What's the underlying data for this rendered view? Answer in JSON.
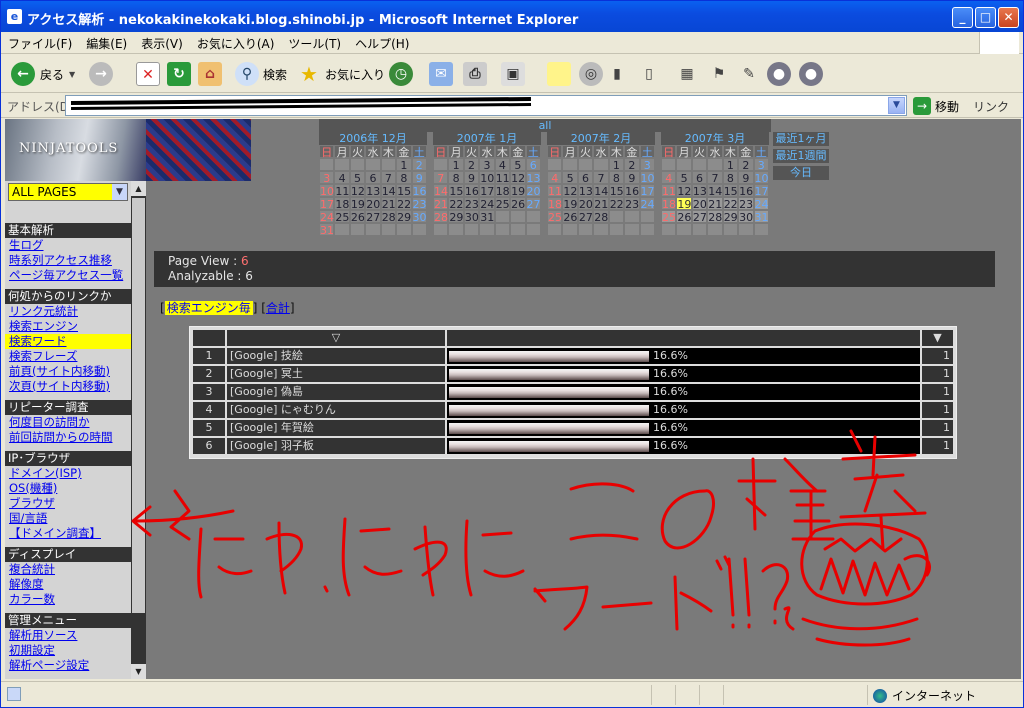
{
  "window": {
    "title": "アクセス解析 - nekokakinekokaki.blog.shinobi.jp - Microsoft Internet Explorer",
    "minimize": "_",
    "maximize": "□",
    "close": "✕"
  },
  "menu": [
    "ファイル(F)",
    "編集(E)",
    "表示(V)",
    "お気に入り(A)",
    "ツール(T)",
    "ヘルプ(H)"
  ],
  "toolbar": {
    "back": "戻る",
    "search": "検索",
    "favorites": "お気に入り"
  },
  "address": {
    "label": "アドレス(D)",
    "go": "移動",
    "links": "リンク"
  },
  "sidebar": {
    "logo": "NINJATOOLS",
    "select": "ALL PAGES",
    "sections": [
      {
        "title": "基本解析",
        "items": [
          "生ログ",
          "時系列アクセス推移",
          "ページ毎アクセス一覧"
        ]
      },
      {
        "title": "何処からのリンクか",
        "items": [
          "リンク元統計",
          "検索エンジン",
          "検索ワード",
          "検索フレーズ",
          "前頁(サイト内移動)",
          "次頁(サイト内移動)"
        ]
      },
      {
        "title": "リピーター調査",
        "items": [
          "何度目の訪問か",
          "前回訪問からの時間"
        ]
      },
      {
        "title": "IP･ブラウザ",
        "items": [
          "ドメイン(ISP)",
          "OS(機種)",
          "ブラウザ",
          "国/言語",
          "【ドメイン調査】"
        ]
      },
      {
        "title": "ディスプレイ",
        "items": [
          "複合統計",
          "解像度",
          "カラー数"
        ]
      },
      {
        "title": "管理メニュー",
        "items": [
          "解析用ソース",
          "初期設定",
          "解析ページ設定"
        ]
      }
    ]
  },
  "calendar": {
    "all": "all",
    "weekdays": [
      "日",
      "月",
      "火",
      "水",
      "木",
      "金",
      "土"
    ],
    "months": [
      {
        "label": "2006年 12月",
        "start": 5,
        "days": 31
      },
      {
        "label": "2007年 1月",
        "start": 1,
        "days": 31
      },
      {
        "label": "2007年 2月",
        "start": 4,
        "days": 28
      },
      {
        "label": "2007年 3月",
        "start": 4,
        "days": 31,
        "today": 19
      }
    ],
    "quick": [
      "最近1ヶ月",
      "最近1週間",
      "今日"
    ]
  },
  "summary": {
    "pv_label": "Page View : ",
    "pv": "6",
    "an_label": "Analyzable : ",
    "an": "6"
  },
  "filter": {
    "current": "検索エンジン毎",
    "other": "合計"
  },
  "table": {
    "header_sort": "▽",
    "header_count": "▼",
    "rows": [
      {
        "rank": "1",
        "word": "[Google] 技絵",
        "pct": "16.6%",
        "count": "1"
      },
      {
        "rank": "2",
        "word": "[Google] 冥土",
        "pct": "16.6%",
        "count": "1"
      },
      {
        "rank": "3",
        "word": "[Google] 偽島",
        "pct": "16.6%",
        "count": "1"
      },
      {
        "rank": "4",
        "word": "[Google] にゃむりん",
        "pct": "16.6%",
        "count": "1"
      },
      {
        "rank": "5",
        "word": "[Google] 年賀絵",
        "pct": "16.6%",
        "count": "1"
      },
      {
        "rank": "6",
        "word": "[Google] 羽子板",
        "pct": "16.6%",
        "count": "1"
      }
    ]
  },
  "annotation": {
    "line1": "にゃ、にゃに、この検索",
    "line2": "ワード!!?",
    "color": "#ee0000"
  },
  "status": {
    "zone": "インターネット"
  }
}
